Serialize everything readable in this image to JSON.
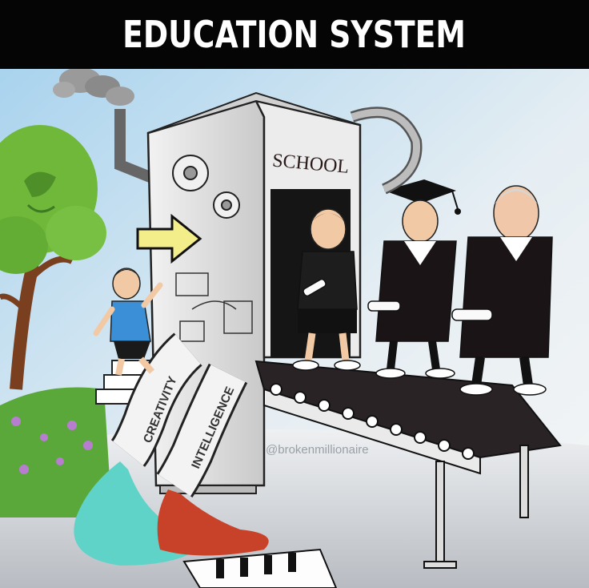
{
  "title": "EDUCATION SYSTEM",
  "machine_label": "SCHOOL",
  "pipes": [
    {
      "label": "CREATIVITY",
      "color": "#5fd3c8"
    },
    {
      "label": "INTELLIGENCE",
      "color": "#c8422a"
    }
  ],
  "watermark": "@brokenmillionaire",
  "colors": {
    "title_bar": "#050505",
    "title_text": "#ffffff",
    "sky": "#b9dcef",
    "tree_leaves": "#6fb83a",
    "grass": "#5aa83a",
    "machine": "#d9d9d9",
    "arrow": "#f4ee8a",
    "kid_shirt": "#3a8fd6",
    "gown": "#1a1416",
    "conveyor": "#2a2326"
  },
  "icons": [
    "gear-icon",
    "arrow-right-icon",
    "graduation-cap-icon",
    "diploma-scroll-icon",
    "tree-icon",
    "smoke-icon"
  ]
}
